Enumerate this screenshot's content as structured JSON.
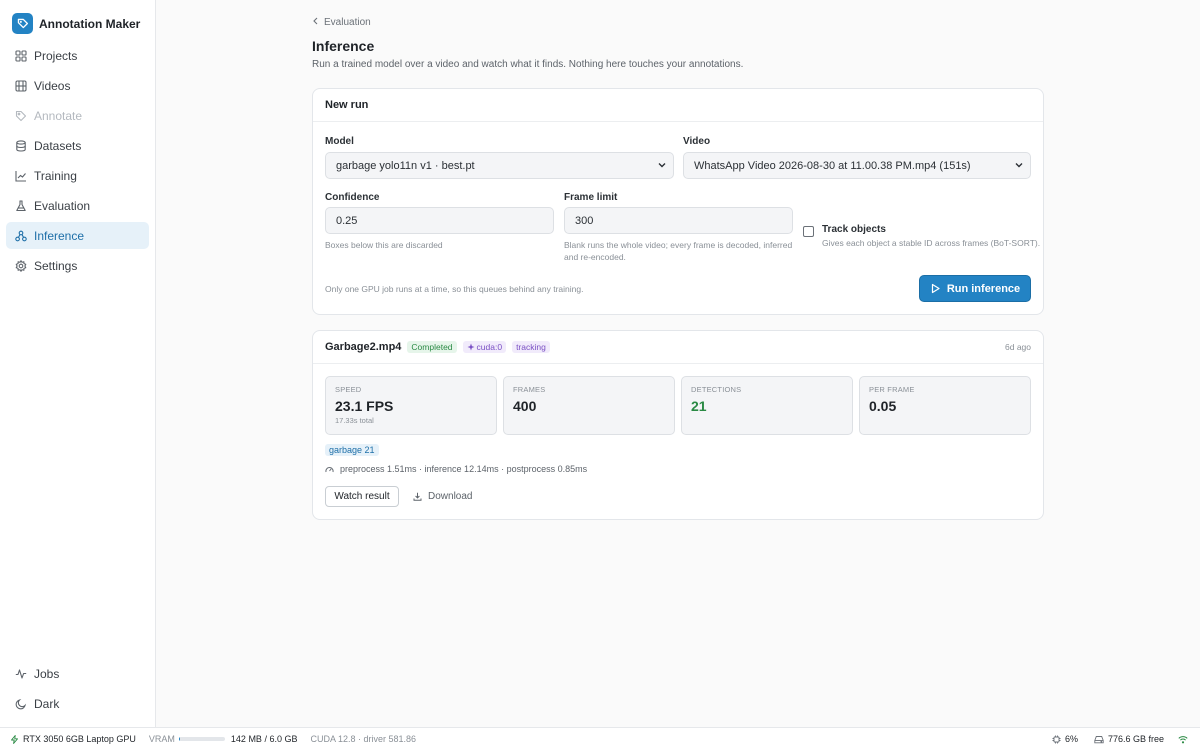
{
  "app": {
    "name": "Annotation Maker"
  },
  "sidebar": {
    "items": [
      {
        "label": "Projects",
        "icon": "grid-icon",
        "state": "normal"
      },
      {
        "label": "Videos",
        "icon": "film-icon",
        "state": "normal"
      },
      {
        "label": "Annotate",
        "icon": "tag-icon",
        "state": "disabled"
      },
      {
        "label": "Datasets",
        "icon": "database-icon",
        "state": "normal"
      },
      {
        "label": "Training",
        "icon": "chart-line-icon",
        "state": "normal"
      },
      {
        "label": "Evaluation",
        "icon": "flask-icon",
        "state": "normal"
      },
      {
        "label": "Inference",
        "icon": "network-icon",
        "state": "active"
      },
      {
        "label": "Settings",
        "icon": "gear-icon",
        "state": "normal"
      }
    ],
    "bottom": [
      {
        "label": "Jobs",
        "icon": "activity-icon"
      },
      {
        "label": "Dark",
        "icon": "moon-icon"
      }
    ]
  },
  "breadcrumb": {
    "label": "Evaluation"
  },
  "page": {
    "title": "Inference",
    "subtitle": "Run a trained model over a video and watch what it finds. Nothing here touches your annotations."
  },
  "new_run": {
    "title": "New run",
    "model_label": "Model",
    "model_value": "garbage yolo11n v1 · best.pt",
    "video_label": "Video",
    "video_value": "WhatsApp Video 2026-08-30 at 11.00.38 PM.mp4 (151s)",
    "confidence_label": "Confidence",
    "confidence_value": "0.25",
    "confidence_hint": "Boxes below this are discarded",
    "frame_limit_label": "Frame limit",
    "frame_limit_value": "300",
    "frame_limit_hint": "Blank runs the whole video; every frame is decoded, inferred and re-encoded.",
    "track_label": "Track objects",
    "track_hint": "Gives each object a stable ID across frames (BoT-SORT).",
    "track_checked": false,
    "queue_note": "Only one GPU job runs at a time, so this queues behind any training.",
    "run_button": "Run inference"
  },
  "result": {
    "filename": "Garbage2.mp4",
    "status": "Completed",
    "device": "cuda:0",
    "mode": "tracking",
    "time_ago": "6d ago",
    "stats": [
      {
        "label": "SPEED",
        "value": "23.1 FPS",
        "sub": "17.33s total"
      },
      {
        "label": "FRAMES",
        "value": "400",
        "sub": ""
      },
      {
        "label": "DETECTIONS",
        "value": "21",
        "sub": ""
      },
      {
        "label": "PER FRAME",
        "value": "0.05",
        "sub": ""
      }
    ],
    "class_chip": "garbage 21",
    "timings": "preprocess 1.51ms · inference 12.14ms · postprocess 0.85ms",
    "watch_button": "Watch result",
    "download_link": "Download"
  },
  "statusbar": {
    "gpu": "RTX 3050 6GB Laptop GPU",
    "vram_label": "VRAM",
    "vram_value": "142 MB / 6.0 GB",
    "vram_fraction": 0.023,
    "cuda": "CUDA 12.8 · driver 581.86",
    "cpu": "6%",
    "disk": "776.6 GB free"
  },
  "colors": {
    "accent": "#2383c4",
    "active_bg": "#e6f1f9",
    "success": "#2a8a44",
    "purple": "#7a4fc4"
  }
}
